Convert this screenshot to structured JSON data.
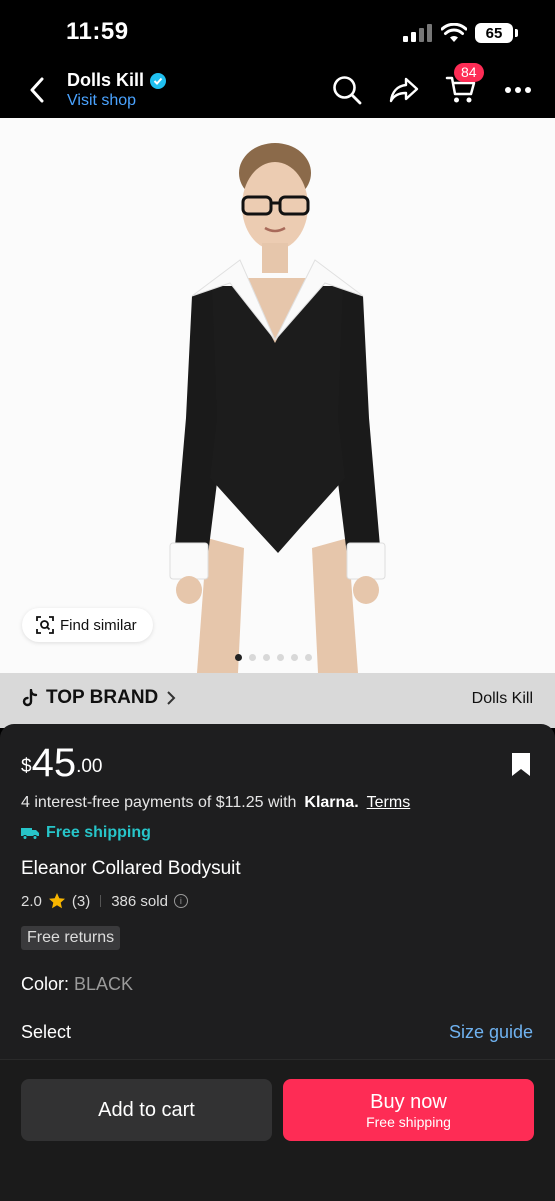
{
  "status_bar": {
    "time": "11:59",
    "battery": "65"
  },
  "header": {
    "shop_name": "Dolls Kill",
    "visit_shop": "Visit shop",
    "cart_count": "84"
  },
  "gallery": {
    "find_similar": "Find similar",
    "image_count": 6,
    "active_index": 0
  },
  "brand_bar": {
    "label": "TOP BRAND",
    "shop": "Dolls Kill"
  },
  "product": {
    "currency": "$",
    "price_whole": "45",
    "price_cents": ".00",
    "installments_text": "4 interest-free payments of $11.25 with",
    "klarna": "Klarna.",
    "terms": "Terms",
    "shipping": "Free shipping",
    "title": "Eleanor Collared Bodysuit",
    "rating": "2.0",
    "rating_count": "(3)",
    "sold": "386 sold",
    "returns": "Free returns",
    "color_label": "Color:",
    "color_value": "BLACK",
    "select_label": "Select",
    "size_guide": "Size guide"
  },
  "actions": {
    "add_to_cart": "Add to cart",
    "buy_now": "Buy now",
    "buy_now_sub": "Free shipping"
  },
  "colors": {
    "accent": "#fe2c55",
    "shipping": "#27c5c9",
    "link": "#4aa3ff"
  }
}
